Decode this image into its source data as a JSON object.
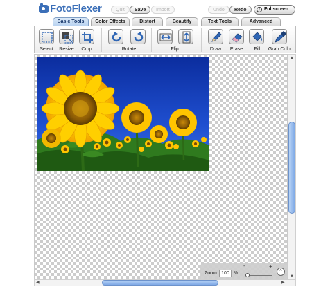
{
  "app": {
    "logo_text": "FotoFlexer",
    "quit_label": "Quit",
    "save_label": "Save",
    "import_label": "Import",
    "undo_label": "Undo",
    "redo_label": "Redo",
    "fullscreen_label": "Fullscreen"
  },
  "tabs": [
    {
      "label": "Basic Tools",
      "active": true
    },
    {
      "label": "Color Effects",
      "active": false
    },
    {
      "label": "Distort",
      "active": false
    },
    {
      "label": "Beautify",
      "active": false
    },
    {
      "label": "Text Tools",
      "active": false
    },
    {
      "label": "Advanced",
      "active": false
    }
  ],
  "tools": {
    "select": {
      "label": "Select",
      "icon": "select-icon"
    },
    "resize": {
      "label": "Resize",
      "icon": "resize-icon"
    },
    "crop": {
      "label": "Crop",
      "icon": "crop-icon"
    },
    "rotate": {
      "label": "Rotate",
      "icon": "rotate-icon"
    },
    "flip": {
      "label": "Flip",
      "icon": "flip-icon"
    },
    "draw": {
      "label": "Draw",
      "icon": "pencil-icon"
    },
    "erase": {
      "label": "Erase",
      "icon": "eraser-icon"
    },
    "fill": {
      "label": "Fill",
      "icon": "paint-bucket-icon"
    },
    "grab_color": {
      "label": "Grab Color",
      "icon": "eyedropper-icon"
    }
  },
  "zoom": {
    "label": "Zoom:",
    "value": "100",
    "unit": "%",
    "minus": "-",
    "plus": "+"
  },
  "colors": {
    "accent": "#3b6fb8",
    "active_tab": "#b8d2f0",
    "scroll_thumb": "#7fa9e6"
  }
}
